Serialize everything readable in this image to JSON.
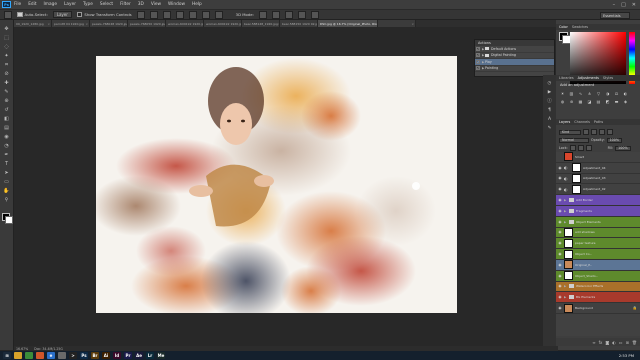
{
  "app": {
    "logo": "Ps"
  },
  "menu": [
    "File",
    "Edit",
    "Image",
    "Layer",
    "Type",
    "Select",
    "Filter",
    "3D",
    "View",
    "Window",
    "Help"
  ],
  "window_controls": {
    "minimize": "–",
    "maximize": "□",
    "close": "✕"
  },
  "options_bar": {
    "auto_select_label": "Auto-Select:",
    "auto_select_value": "Layer",
    "show_transform_label": "Show Transform Controls",
    "mode_3d_label": "3D Mode:",
    "workspace": "Essentials"
  },
  "tabs": [
    {
      "label": "09_1920_1280.jpg"
    },
    {
      "label": "parrot8 04 1920.jpg"
    },
    {
      "label": "pexels-768048 1920.jpg"
    },
    {
      "label": "pexels-768050 1920.jpg"
    },
    {
      "label": "woman-609192 1920.jpg"
    },
    {
      "label": "woman-609192 1920.jpg"
    },
    {
      "label": "bear-588148_1920.jpg"
    },
    {
      "label": "bear-588150 1920 02.jpg"
    },
    {
      "label": "DSC.jpg @ 16.7% (Original_Photo, RGB/8)",
      "active": true
    },
    {
      "label": ""
    }
  ],
  "tools": [
    "move-tool",
    "marquee-tool",
    "lasso-tool",
    "quick-select-tool",
    "crop-tool",
    "eyedropper-tool",
    "healing-brush-tool",
    "brush-tool",
    "clone-stamp-tool",
    "history-brush-tool",
    "eraser-tool",
    "gradient-tool",
    "blur-tool",
    "dodge-tool",
    "pen-tool",
    "type-tool",
    "path-select-tool",
    "shape-tool",
    "hand-tool",
    "zoom-tool"
  ],
  "actions": {
    "tabs": "Actions",
    "items": [
      {
        "label": "Default Actions",
        "folder": true,
        "checked": true
      },
      {
        "label": "Digital Painting",
        "folder": true,
        "checked": true
      },
      {
        "label": "Play",
        "folder": false,
        "checked": true,
        "selected": true
      },
      {
        "label": "Painting",
        "folder": false,
        "checked": true
      }
    ]
  },
  "color_panel": {
    "tabs": [
      "Color",
      "Swatches"
    ]
  },
  "adjustments_panel": {
    "tabs": [
      "Libraries",
      "Adjustments",
      "Styles"
    ],
    "title": "Add an adjustment"
  },
  "layers_panel": {
    "tabs": [
      "Layers",
      "Channels",
      "Paths"
    ],
    "kind_label": "Kind",
    "blend_mode": "Normal",
    "opacity_label": "Opacity:",
    "opacity_value": "100%",
    "lock_label": "Lock:",
    "fill_label": "Fill:",
    "fill_value": "100%",
    "layers": [
      {
        "name": "Smart",
        "type": "layer",
        "visible": false,
        "color": "#414141"
      },
      {
        "name": "Adjustment_04",
        "type": "adjust",
        "visible": true,
        "color": "#414141"
      },
      {
        "name": "Adjustment_03",
        "type": "adjust",
        "visible": true,
        "color": "#414141"
      },
      {
        "name": "Adjustment_02",
        "type": "adjust",
        "visible": true,
        "color": "#414141"
      },
      {
        "name": "Add Border",
        "type": "folder",
        "visible": true,
        "color": "#6a4bb0"
      },
      {
        "name": "Fragments",
        "type": "folder",
        "visible": true,
        "color": "#6a4bb0"
      },
      {
        "name": "Object Elements",
        "type": "folder",
        "visible": true,
        "color": "#5e8a2c"
      },
      {
        "name": "add shadows",
        "type": "layer",
        "visible": true,
        "color": "#5e8a2c"
      },
      {
        "name": "paper texture",
        "type": "layer",
        "visible": true,
        "color": "#5e8a2c"
      },
      {
        "name": "Object Co...",
        "type": "layer",
        "visible": true,
        "color": "#5e8a2c"
      },
      {
        "name": "Original_P...",
        "type": "layer",
        "visible": true,
        "selected": true,
        "color": "#5c6e8c"
      },
      {
        "name": "Object_Shado...",
        "type": "layer",
        "visible": true,
        "color": "#5e8a2c"
      },
      {
        "name": "Watercolor Effects",
        "type": "folder",
        "visible": true,
        "color": "#a9702a"
      },
      {
        "name": "BG Elements",
        "type": "folder",
        "visible": true,
        "color": "#a83a2c"
      },
      {
        "name": "Background",
        "type": "layer",
        "visible": true,
        "locked": true,
        "color": "#414141"
      }
    ]
  },
  "status": {
    "zoom": "16.67%",
    "doc": "Doc: 34.4M/1.25G"
  },
  "taskbar": {
    "apps": [
      {
        "name": "start-icon",
        "color": "#1b2a3a",
        "label": "⊞"
      },
      {
        "name": "explorer-icon",
        "color": "#d7a22a",
        "label": ""
      },
      {
        "name": "chrome-icon",
        "color": "#3c8d3a",
        "label": ""
      },
      {
        "name": "firefox-icon",
        "color": "#d1562a",
        "label": ""
      },
      {
        "name": "ie-icon",
        "color": "#2a6fc9",
        "label": "e"
      },
      {
        "name": "media-icon",
        "color": "#6a6a6a",
        "label": ""
      },
      {
        "name": "terminal-icon",
        "color": "#222222",
        "label": ">"
      },
      {
        "name": "photoshop-icon",
        "color": "#0e2a47",
        "label": "Ps"
      },
      {
        "name": "bridge-icon",
        "color": "#5a3a0a",
        "label": "Br"
      },
      {
        "name": "illustrator-icon",
        "color": "#3a1e00",
        "label": "Ai"
      },
      {
        "name": "indesign-icon",
        "color": "#3a0a2a",
        "label": "Id"
      },
      {
        "name": "premiere-icon",
        "color": "#1a1a4a",
        "label": "Pr"
      },
      {
        "name": "aftereffects-icon",
        "color": "#1a1a3a",
        "label": "Ae"
      },
      {
        "name": "lightroom-icon",
        "color": "#0a2a3a",
        "label": "Lr"
      },
      {
        "name": "media-encoder-icon",
        "color": "#1a2a2a",
        "label": "Me"
      }
    ],
    "clock": "2:53 PM"
  }
}
